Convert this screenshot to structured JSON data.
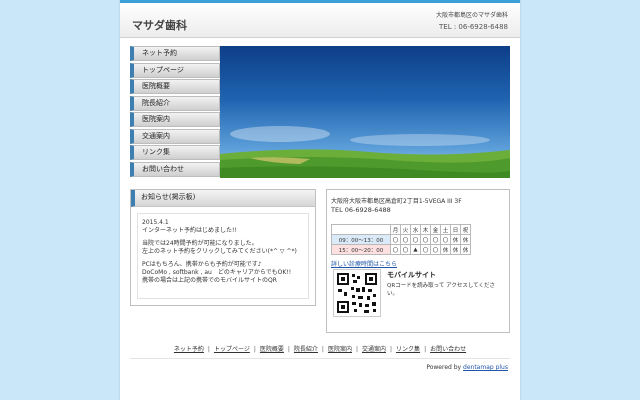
{
  "header": {
    "site_title": "マサダ歯科",
    "address": "大阪市都島区のマサダ歯科",
    "tel": "TEL : 06-6928-6488"
  },
  "nav": {
    "items": [
      {
        "label": "ネット予約"
      },
      {
        "label": "トップページ"
      },
      {
        "label": "医院概要"
      },
      {
        "label": "院長紹介"
      },
      {
        "label": "医院案内"
      },
      {
        "label": "交通案内"
      },
      {
        "label": "リンク集"
      },
      {
        "label": "お問い合わせ"
      }
    ]
  },
  "notice": {
    "title": "お知らせ(掲示板)",
    "lines": [
      "2015.4.1",
      "インターネット予約はじめました!!",
      "当院では24時間予約が可能になりました。",
      "左上のネット予約をクリックしてみてください(*^ ▽ ^*)",
      "PCはもちろん、携帯からも予約が可能です♪",
      "DoCoMo , softbank , au　どのキャリアからでもOK!!",
      "携帯の場合は上記の携帯でのモバイルサイトのQR"
    ]
  },
  "info": {
    "address": "大阪府大阪市都島区高倉町2丁目1-5VEGA III 3F",
    "tel": "TEL 06-6928-6488",
    "schedule": {
      "days": [
        "月",
        "火",
        "水",
        "木",
        "金",
        "土",
        "日",
        "祝"
      ],
      "rows": [
        {
          "time": "09：00～13：00",
          "marks": [
            "〇",
            "〇",
            "〇",
            "〇",
            "〇",
            "〇",
            "休",
            "休"
          ]
        },
        {
          "time": "15：00～20：00",
          "marks": [
            "〇",
            "〇",
            "▲",
            "〇",
            "〇",
            "休",
            "休",
            "休"
          ]
        }
      ]
    },
    "schedule_link": "詳しい診療時間はこちら",
    "mobile_title": "モバイルサイト",
    "mobile_desc": "QRコードを読み取って アクセスしてください。"
  },
  "footer": {
    "links": [
      {
        "label": "ネット予約"
      },
      {
        "label": "トップページ"
      },
      {
        "label": "医院概要"
      },
      {
        "label": "院長紹介"
      },
      {
        "label": "医院案内"
      },
      {
        "label": "交通案内"
      },
      {
        "label": "リンク集"
      },
      {
        "label": "お問い合わせ"
      }
    ],
    "powered_prefix": "Powered by",
    "powered_link": "dentamap plus"
  },
  "colors": {
    "page_bg": "#c9e7f8",
    "accent": "#3d7fb1",
    "link": "#2056a8"
  }
}
